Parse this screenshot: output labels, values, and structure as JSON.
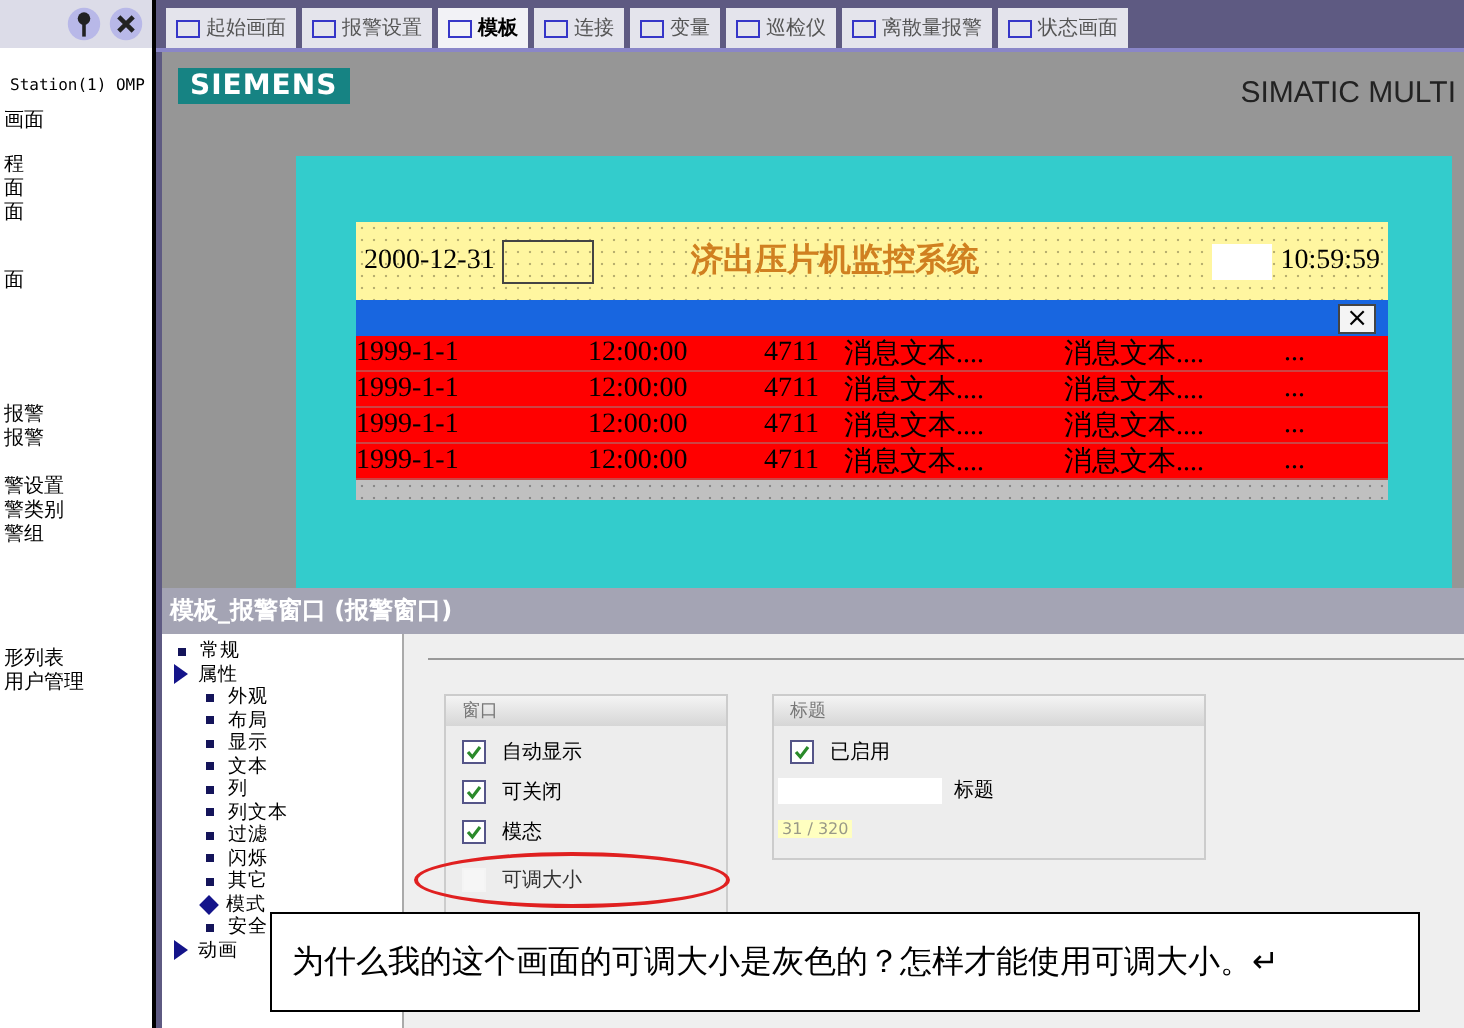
{
  "sidebar": {
    "station": "Station(1) OMP",
    "items": [
      "画面",
      "程",
      "面",
      "面",
      "面",
      "报警",
      "报警",
      "警设置",
      "警类别",
      "警组",
      "形列表",
      "用户管理"
    ]
  },
  "tabs": [
    {
      "label": "起始画面",
      "selected": false
    },
    {
      "label": "报警设置",
      "selected": false
    },
    {
      "label": "模板",
      "selected": true
    },
    {
      "label": "连接",
      "selected": false
    },
    {
      "label": "变量",
      "selected": false
    },
    {
      "label": "巡检仪",
      "selected": false
    },
    {
      "label": "离散量报警",
      "selected": false
    },
    {
      "label": "状态画面",
      "selected": false
    }
  ],
  "editor": {
    "logo": "SIEMENS",
    "device": "SIMATIC MULTI",
    "header": {
      "date": "2000-12-31",
      "title": "济出压片机监控系统",
      "time": "10:59:59"
    },
    "close_symbol": "×",
    "alarm_rows": [
      {
        "date": "1999-1-1",
        "time": "12:00:00",
        "number": "4711",
        "text_1": "消息文本....",
        "text_2": "消息文本....",
        "text_3": "..."
      },
      {
        "date": "1999-1-1",
        "time": "12:00:00",
        "number": "4711",
        "text_1": "消息文本....",
        "text_2": "消息文本....",
        "text_3": "..."
      },
      {
        "date": "1999-1-1",
        "time": "12:00:00",
        "number": "4711",
        "text_1": "消息文本....",
        "text_2": "消息文本....",
        "text_3": "..."
      },
      {
        "date": "1999-1-1",
        "time": "12:00:00",
        "number": "4711",
        "text_1": "消息文本....",
        "text_2": "消息文本....",
        "text_3": "..."
      }
    ]
  },
  "properties": {
    "title": "模板_报警窗口 (报警窗口)",
    "tree": [
      {
        "label": "常规",
        "kind": "leaf",
        "selected": false
      },
      {
        "label": "属性",
        "kind": "folder",
        "expanded": true,
        "selected": false,
        "children": [
          {
            "label": "外观",
            "selected": false
          },
          {
            "label": "布局",
            "selected": false
          },
          {
            "label": "显示",
            "selected": false
          },
          {
            "label": "文本",
            "selected": false
          },
          {
            "label": "列",
            "selected": false
          },
          {
            "label": "列文本",
            "selected": false
          },
          {
            "label": "过滤",
            "selected": false
          },
          {
            "label": "闪烁",
            "selected": false
          },
          {
            "label": "其它",
            "selected": false
          },
          {
            "label": "模式",
            "selected": true
          },
          {
            "label": "安全",
            "selected": false
          }
        ]
      },
      {
        "label": "动画",
        "kind": "folder",
        "expanded": false,
        "selected": false
      }
    ],
    "window_group": {
      "title": "窗口",
      "options": [
        {
          "label": "自动显示",
          "checked": true,
          "disabled": false
        },
        {
          "label": "可关闭",
          "checked": true,
          "disabled": false
        },
        {
          "label": "模态",
          "checked": true,
          "disabled": false
        },
        {
          "label": "可调大小",
          "checked": false,
          "disabled": true
        }
      ]
    },
    "title_group": {
      "title": "标题",
      "enabled": {
        "label": "已启用",
        "checked": true
      },
      "field_label": "标题",
      "counter": "31 / 320"
    }
  },
  "callout": "为什么我的这个画面的可调大小是灰色的？怎样才能使用可调大小。↵"
}
